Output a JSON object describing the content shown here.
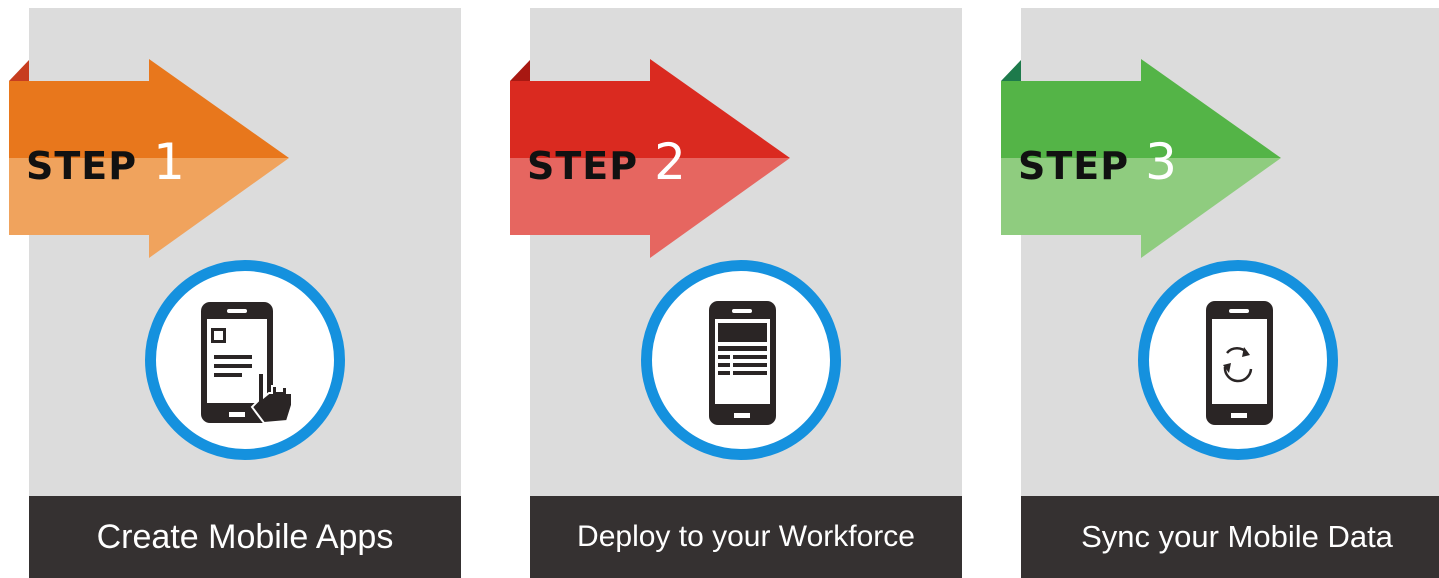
{
  "steps": [
    {
      "word": "STEP",
      "number": "1",
      "caption": "Create Mobile Apps",
      "arrow_dark": "#e8771c",
      "arrow_light": "#f0a35d",
      "fold": "#c73d1f",
      "icon": "phone-tap-icon"
    },
    {
      "word": "STEP",
      "number": "2",
      "caption": "Deploy to your Workforce",
      "arrow_dark": "#da2a20",
      "arrow_light": "#e66660",
      "fold": "#a81812",
      "icon": "phone-form-icon"
    },
    {
      "word": "STEP",
      "number": "3",
      "caption": "Sync your Mobile Data",
      "arrow_dark": "#54b447",
      "arrow_light": "#8fcc7f",
      "fold": "#1d7a4b",
      "icon": "phone-sync-icon"
    }
  ],
  "ring_color": "#1591de",
  "caption_bar_color": "#353131"
}
